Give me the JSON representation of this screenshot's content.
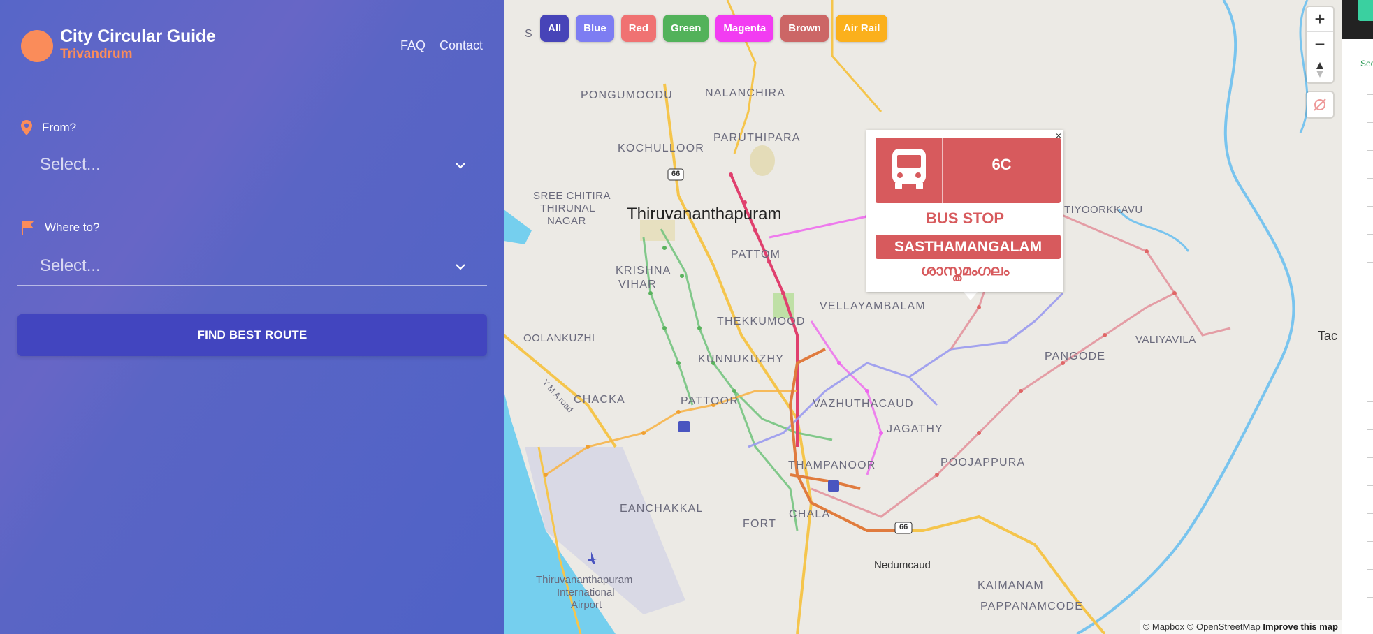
{
  "app": {
    "title": "City Circular Guide",
    "city": "Trivandrum"
  },
  "nav": {
    "faq": "FAQ",
    "contact": "Contact"
  },
  "form": {
    "from_label": "From?",
    "from_placeholder": "Select...",
    "to_label": "Where to?",
    "to_placeholder": "Select...",
    "submit_label": "FIND BEST ROUTE"
  },
  "filters": [
    {
      "label": "All",
      "color": "#4744b8"
    },
    {
      "label": "Blue",
      "color": "#7d7df2"
    },
    {
      "label": "Red",
      "color": "#f07272"
    },
    {
      "label": "Green",
      "color": "#52b25a"
    },
    {
      "label": "Magenta",
      "color": "#f23cf2"
    },
    {
      "label": "Brown",
      "color": "#cc6666"
    },
    {
      "label": "Air Rail",
      "color": "#fbb01c"
    }
  ],
  "popup": {
    "route": "6C",
    "stop_heading": "BUS STOP",
    "stop_name": "SASTHAMANGALAM",
    "stop_name_local": "ശാസ്തമംഗലം",
    "close": "×"
  },
  "map": {
    "labels": {
      "city": "Thiruvananthapuram",
      "pongumoodu": "PONGUMOODU",
      "nalanchira": "NALANCHIRA",
      "kochulloor": "KOCHULLOOR",
      "paruthipara": "PARUTHIPARA",
      "sree_chitira": "SREE CHITIRA",
      "thirunal": "THIRUNAL",
      "nagar": "NAGAR",
      "pattom": "PATTOM",
      "krishna": "KRISHNA",
      "vihar": "VIHAR",
      "vellayambalam": "VELLAYAMBALAM",
      "thekkumood": "THEKKUMOOD",
      "oolankuzhi": "OOLANKUZHI",
      "kunnukuzhy": "KUNNUKUZHY",
      "chackai": "CHACKA",
      "pattoor": "PATTOOR",
      "vazhuthacaud": "VAZHUTHACAUD",
      "jagathy": "JAGATHY",
      "thampanoor": "THAMPANOOR",
      "poojappura": "POOJAPPURA",
      "eanchakkal": "EANCHAKKAL",
      "fort": "FORT",
      "chala": "CHALA",
      "nedumcaud": "Nedumcaud",
      "kaimanam": "KAIMANAM",
      "pappanamcode": "PAPPANAMCODE",
      "pangode": "PANGODE",
      "valiyavila": "VALIYAVILA",
      "thiyoorkkavu": "TIYOORKKAVU",
      "airport1": "Thiruvananthapuram",
      "airport2": "International",
      "airport3": "Airport",
      "ymr_road": "Y M A road",
      "tac": "Tac",
      "nh66": "66",
      "sreekaryam": "S"
    },
    "attribution_mapbox": "© Mapbox",
    "attribution_osm": "© OpenStreetMap",
    "improve": "Improve this map"
  },
  "controls": {
    "zoom_in": "+",
    "zoom_out": "−"
  },
  "right_strip": {
    "text": "See"
  }
}
